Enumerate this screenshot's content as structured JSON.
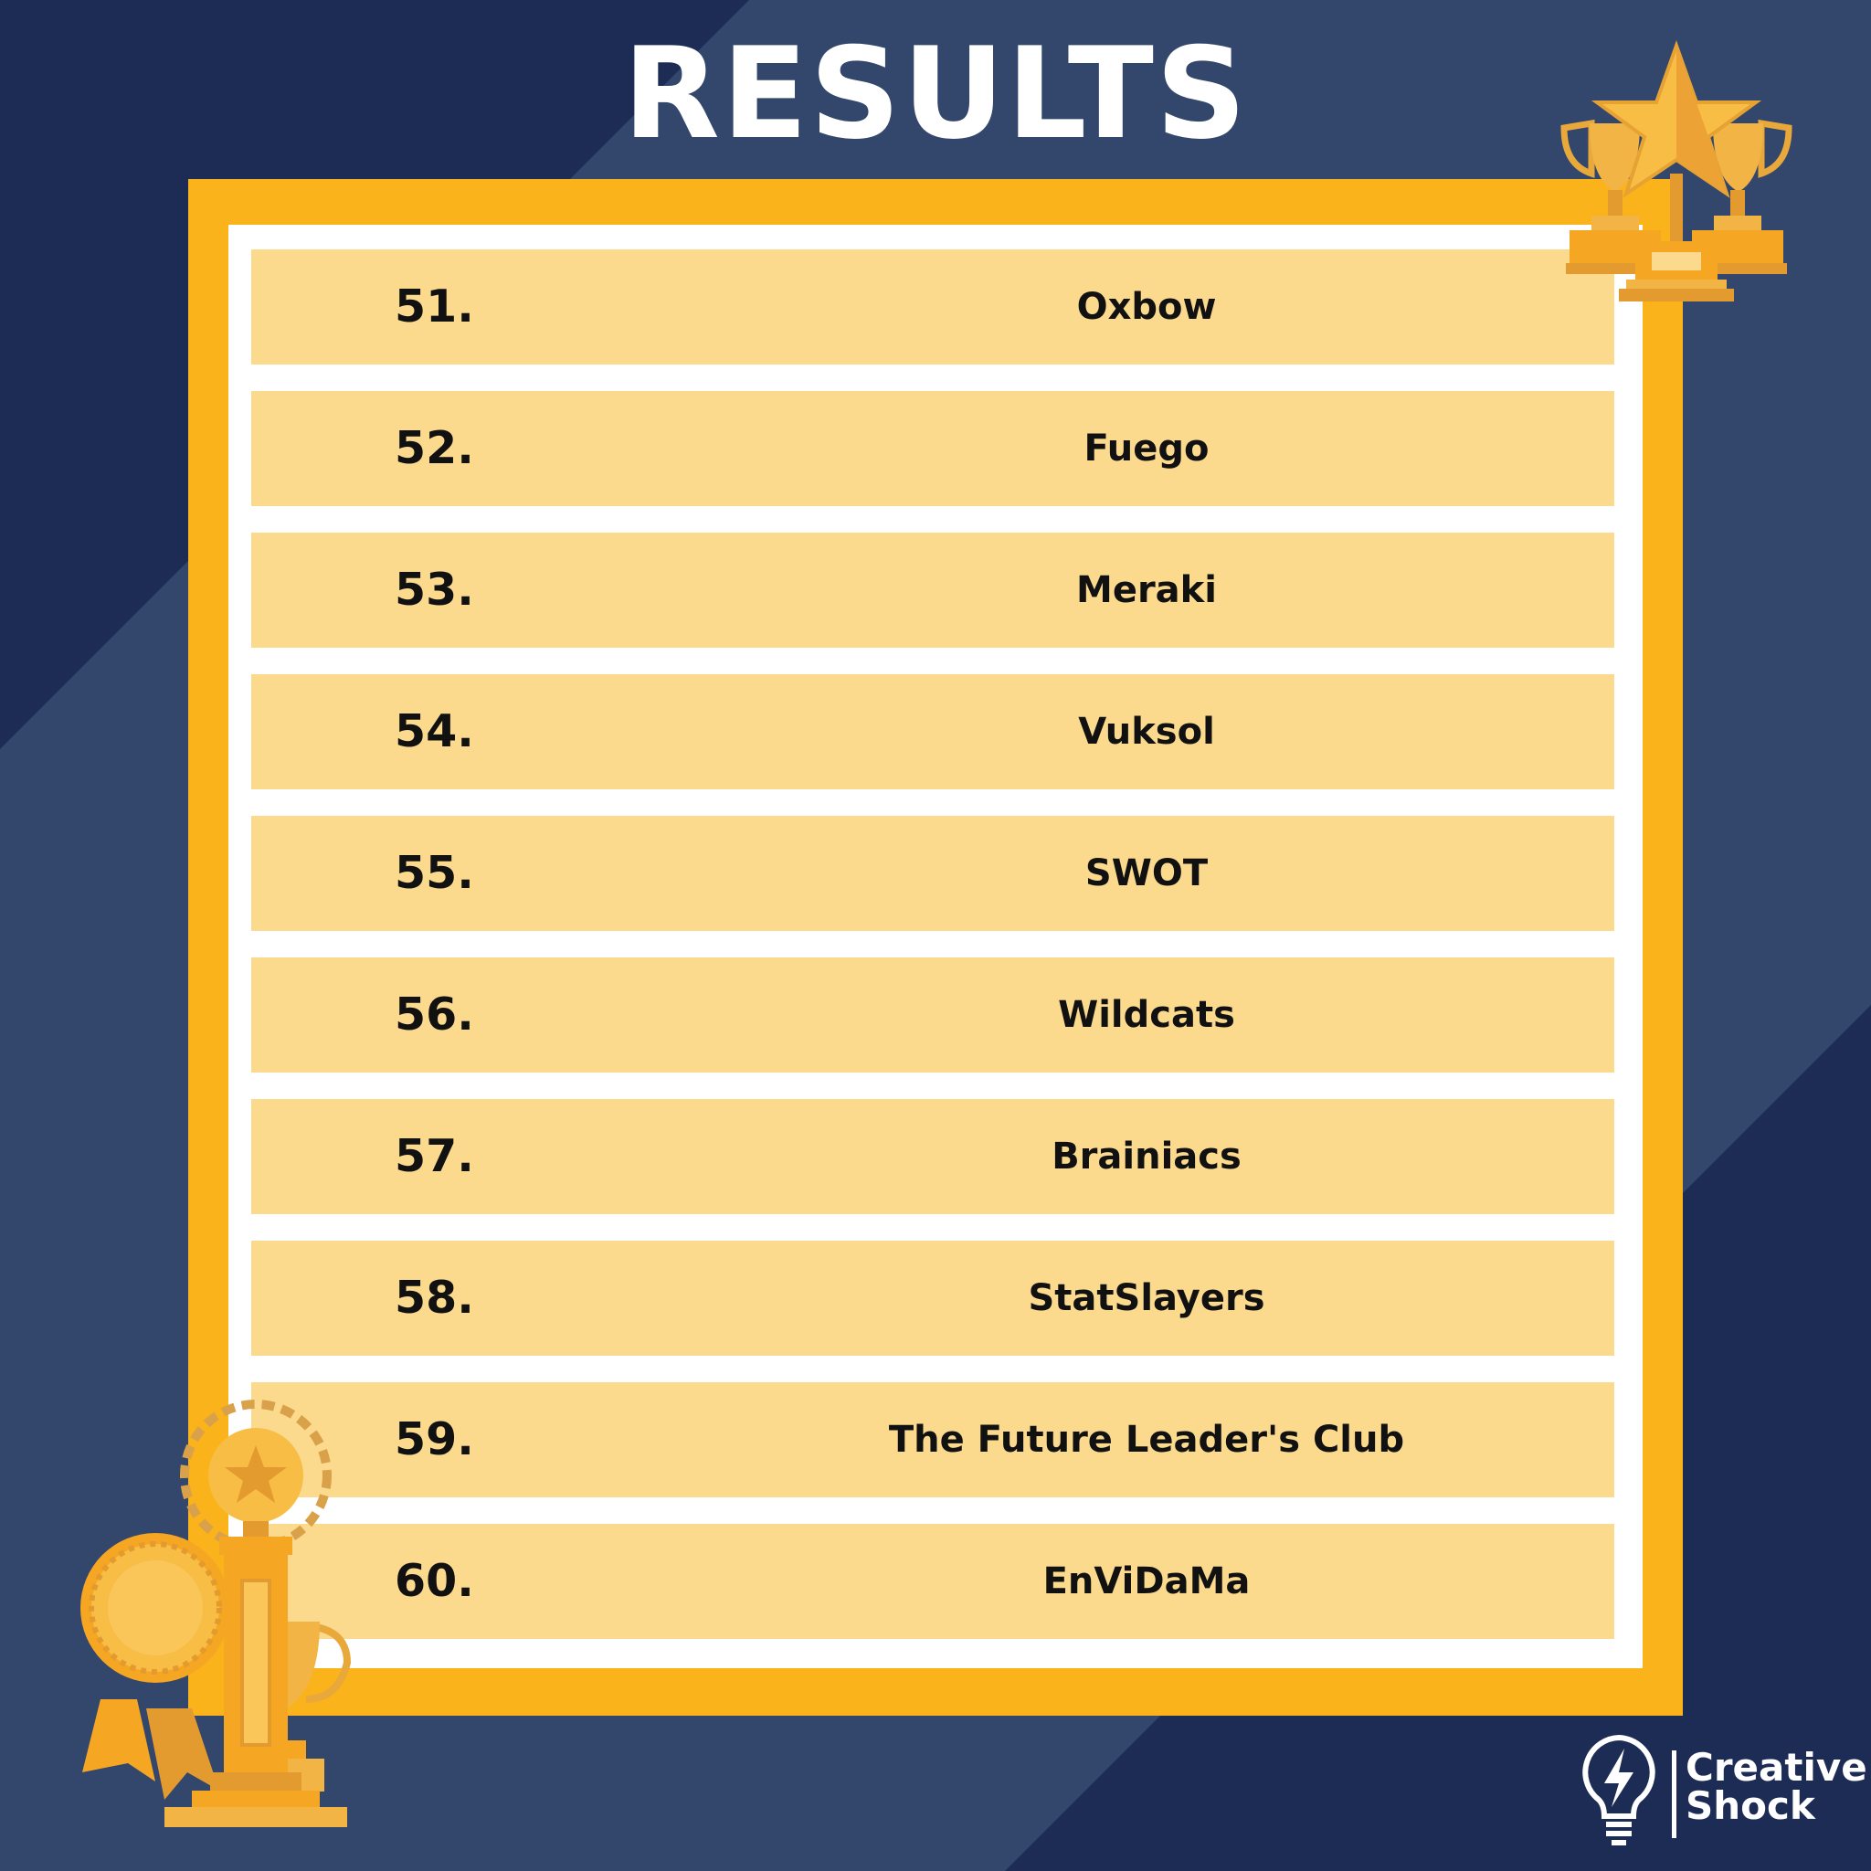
{
  "title": "RESULTS",
  "results": [
    {
      "rank": "51.",
      "team": "Oxbow"
    },
    {
      "rank": "52.",
      "team": "Fuego"
    },
    {
      "rank": "53.",
      "team": "Meraki"
    },
    {
      "rank": "54.",
      "team": "Vuksol"
    },
    {
      "rank": "55.",
      "team": "SWOT"
    },
    {
      "rank": "56.",
      "team": "Wildcats"
    },
    {
      "rank": "57.",
      "team": "Brainiacs"
    },
    {
      "rank": "58.",
      "team": "StatSlayers"
    },
    {
      "rank": "59.",
      "team": "The Future Leader's Club"
    },
    {
      "rank": "60.",
      "team": "EnViDaMa"
    }
  ],
  "brand": {
    "line1": "Creative",
    "line2": "Shock"
  },
  "colors": {
    "background_dark": "#1c2c55",
    "background_light": "#33466b",
    "frame": "#fbb31b",
    "row": "#fbd98d",
    "trophy_gold": "#f5a623",
    "text": "#111111"
  },
  "icons": [
    "trophy-star-cluster-icon",
    "award-rosette-trophy-icon",
    "lightbulb-bolt-icon"
  ]
}
